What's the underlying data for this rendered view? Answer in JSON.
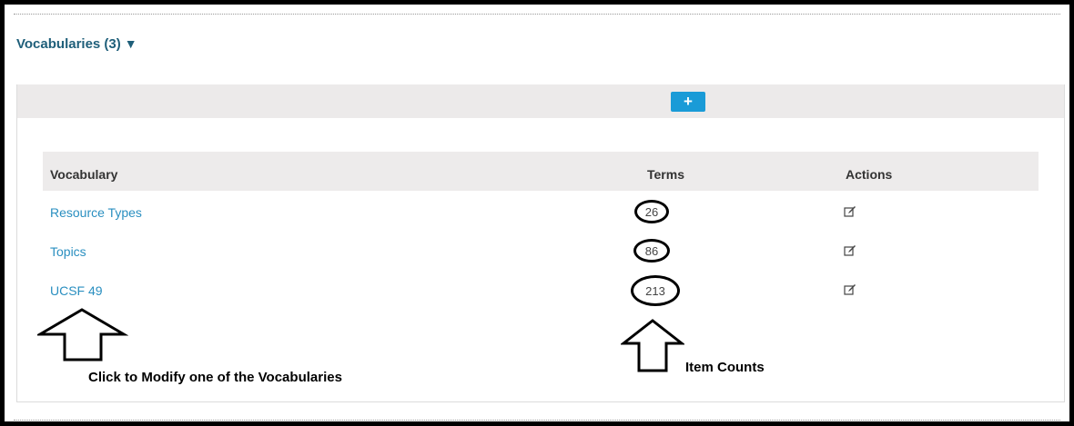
{
  "section": {
    "title": "Vocabularies (3)",
    "caret": "▼"
  },
  "toolbar": {
    "add_label": "+"
  },
  "table": {
    "headers": {
      "vocabulary": "Vocabulary",
      "terms": "Terms",
      "actions": "Actions"
    },
    "rows": [
      {
        "name": "Resource Types",
        "terms": "26"
      },
      {
        "name": "Topics",
        "terms": "86"
      },
      {
        "name": "UCSF 49",
        "terms": "213"
      }
    ]
  },
  "annotations": {
    "modify_note": "Click to Modify one of the Vocabularies",
    "counts_note": "Item Counts"
  },
  "colors": {
    "link": "#2a8fc0",
    "title": "#1f5f7a",
    "button": "#1a9bd7",
    "header_bg": "#edebeb"
  },
  "icons": {
    "edit": "edit-icon",
    "add": "plus-icon"
  }
}
